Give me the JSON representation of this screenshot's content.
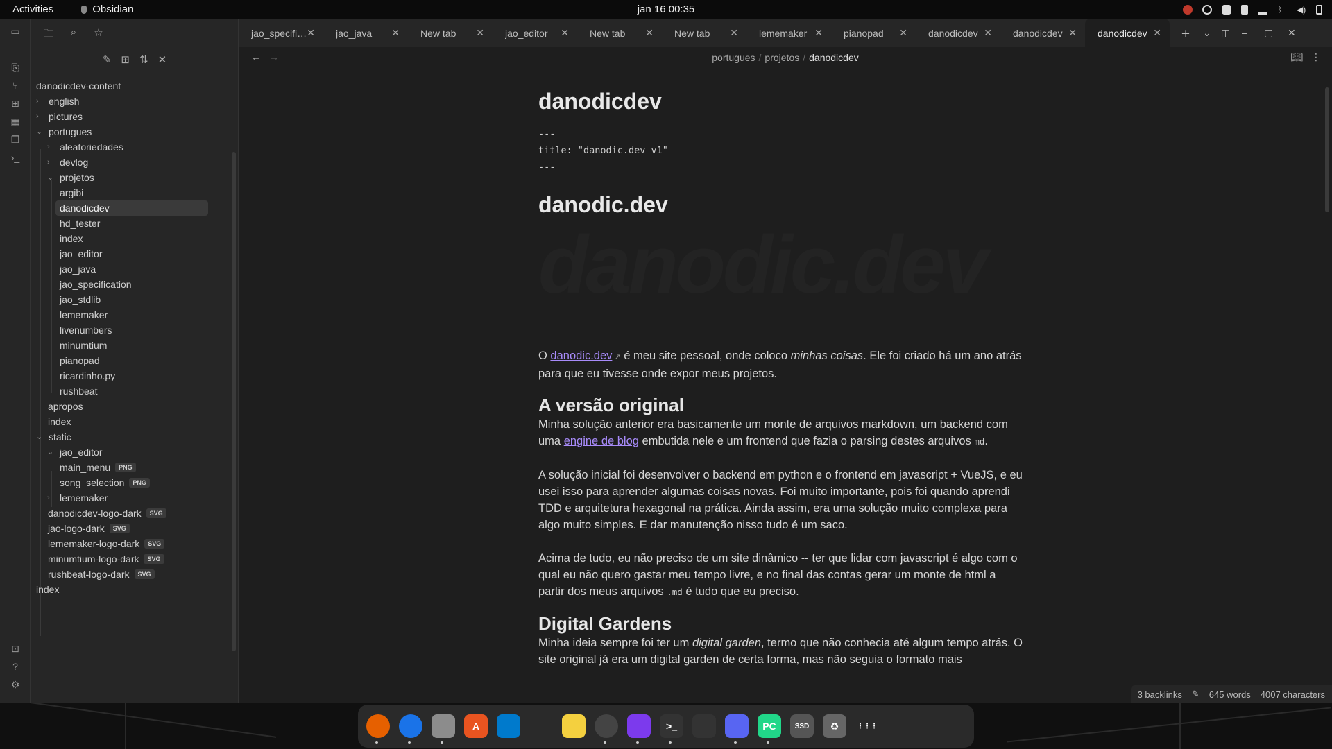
{
  "topbar": {
    "activities": "Activities",
    "app_name": "Obsidian",
    "clock": "jan 16  00:35"
  },
  "tabs": [
    {
      "label": "jao_specific..."
    },
    {
      "label": "jao_java"
    },
    {
      "label": "New tab"
    },
    {
      "label": "jao_editor"
    },
    {
      "label": "New tab"
    },
    {
      "label": "New tab"
    },
    {
      "label": "lememaker"
    },
    {
      "label": "pianopad"
    },
    {
      "label": "danodicdev"
    },
    {
      "label": "danodicdev"
    },
    {
      "label": "danodicdev"
    }
  ],
  "tree": {
    "root": "danodicdev-content",
    "items": [
      {
        "label": "english"
      },
      {
        "label": "pictures"
      },
      {
        "label": "portugues"
      },
      {
        "label": "aleatoriedades"
      },
      {
        "label": "devlog"
      },
      {
        "label": "projetos"
      },
      {
        "label": "argibi"
      },
      {
        "label": "danodicdev"
      },
      {
        "label": "hd_tester"
      },
      {
        "label": "index"
      },
      {
        "label": "jao_editor"
      },
      {
        "label": "jao_java"
      },
      {
        "label": "jao_specification"
      },
      {
        "label": "jao_stdlib"
      },
      {
        "label": "lememaker"
      },
      {
        "label": "livenumbers"
      },
      {
        "label": "minumtium"
      },
      {
        "label": "pianopad"
      },
      {
        "label": "ricardinho.py"
      },
      {
        "label": "rushbeat"
      },
      {
        "label": "apropos"
      },
      {
        "label": "index"
      },
      {
        "label": "static"
      },
      {
        "label": "jao_editor"
      },
      {
        "label": "main_menu",
        "badge": "PNG"
      },
      {
        "label": "song_selection",
        "badge": "PNG"
      },
      {
        "label": "lememaker"
      },
      {
        "label": "danodicdev-logo-dark",
        "badge": "SVG"
      },
      {
        "label": "jao-logo-dark",
        "badge": "SVG"
      },
      {
        "label": "lememaker-logo-dark",
        "badge": "SVG"
      },
      {
        "label": "minumtium-logo-dark",
        "badge": "SVG"
      },
      {
        "label": "rushbeat-logo-dark",
        "badge": "SVG"
      },
      {
        "label": "index"
      }
    ]
  },
  "breadcrumb": {
    "parts": [
      "portugues",
      "projetos",
      "danodicdev"
    ]
  },
  "doc": {
    "title": "danodicdev",
    "frontmatter": [
      "---",
      "title: \"danodic.dev v1\"",
      "---"
    ],
    "h1": "danodic.dev",
    "logo_text": "danodic.dev",
    "p1": {
      "pre": "O ",
      "link": "danodic.dev",
      "mid": " é meu site pessoal, onde coloco ",
      "em": "minhas coisas",
      "post": ". Ele foi criado há um ano atrás para que eu tivesse onde expor meus projetos."
    },
    "h2_original": "A versão original",
    "p2": {
      "pre": "Minha solução anterior era basicamente um monte de arquivos markdown, um backend com uma ",
      "link": "engine de blog",
      "mid": " embutida nele e um frontend que fazia o parsing destes arquivos ",
      "code": "md",
      "post": "."
    },
    "p3": "A solução inicial foi desenvolver o backend em python e o frontend em javascript + VueJS, e eu usei isso para aprender algumas coisas novas. Foi muito importante, pois foi quando aprendi TDD e arquitetura hexagonal na prática. Ainda assim, era uma solução muito complexa para algo muito simples. E dar manutenção nisso tudo é um saco.",
    "p4": {
      "pre": "Acima de tudo, eu não preciso de um site dinâmico -- ter que lidar com javascript é algo com o qual eu não quero gastar meu tempo livre, e no final das contas gerar um monte de html a partir dos meus arquivos ",
      "code": ".md",
      "post": " é tudo que eu preciso."
    },
    "h2_gardens": "Digital Gardens",
    "p5": {
      "pre": "Minha ideia sempre foi ter um ",
      "em": "digital garden",
      "post": ", termo que não conhecia até algum tempo atrás. O site original já era um digital garden de certa forma, mas não seguia o formato mais"
    }
  },
  "status": {
    "backlinks": "3 backlinks",
    "words": "645 words",
    "chars": "4007 characters"
  },
  "dock": [
    {
      "name": "firefox",
      "letter": "",
      "color": "#e66000"
    },
    {
      "name": "chrome",
      "letter": "",
      "color": "#1a73e8"
    },
    {
      "name": "files",
      "letter": "",
      "color": "#8c8c8c"
    },
    {
      "name": "software-center",
      "letter": "A",
      "color": "#e95420"
    },
    {
      "name": "vscode",
      "letter": "",
      "color": "#007acc"
    },
    {
      "name": "git-client",
      "letter": "",
      "color": "#2a2a2a"
    },
    {
      "name": "notes",
      "letter": "",
      "color": "#f4d03f"
    },
    {
      "name": "clock",
      "letter": "",
      "color": "#444"
    },
    {
      "name": "obsidian",
      "letter": "",
      "color": "#7c3aed"
    },
    {
      "name": "terminal",
      "letter": ">_",
      "color": "#333"
    },
    {
      "name": "system-monitor",
      "letter": "",
      "color": "#333"
    },
    {
      "name": "discord",
      "letter": "",
      "color": "#5865f2"
    },
    {
      "name": "pycharm",
      "letter": "PC",
      "color": "#21d789"
    },
    {
      "name": "disk",
      "letter": "SSD",
      "color": "#555"
    },
    {
      "name": "trash",
      "letter": "♻",
      "color": "#666"
    },
    {
      "name": "app-grid",
      "letter": "⋮⋮⋮",
      "color": "#2a2a2a"
    }
  ]
}
